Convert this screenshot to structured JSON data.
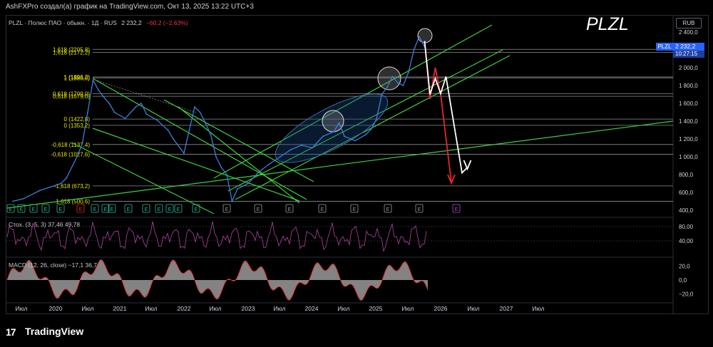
{
  "header": {
    "publisher_text": "AshFXPro создал(а) график на TradingView.com, Окт 13, 2025 13:22 UTC+3"
  },
  "legend": {
    "symbol_line": "PLZL · Полюс ПАО · обыкн. · 1Д · RUS",
    "last": "2 232,2",
    "change": "−60,2 (−2,63%)"
  },
  "big_ticker": "PLZL",
  "currency": "RUB",
  "price_tag": {
    "symbol": "PLZL",
    "value": "2 232,2",
    "time": "10:27:15"
  },
  "colors": {
    "price": "#3d7fd9",
    "fib_line": "#c0c0c0",
    "fib_label": "#e6e600",
    "trend": "#3fcf3f",
    "arrow_red": "#e8262d",
    "arrow_white": "#ffffff",
    "stoch": "#9c3f8f",
    "macd_line": "#e8262d",
    "macd_area": "#9a9a9a",
    "ellipse": "#1a4a8a"
  },
  "chart_data": [
    {
      "type": "line",
      "title": "",
      "series": [
        {
          "name": "",
          "points": [
            [
              "2019-05",
              500
            ],
            [
              "2019-07",
              530
            ],
            [
              "2019-10",
              620
            ],
            [
              "2019-12",
              660
            ],
            [
              "2020-02",
              700
            ],
            [
              "2020-03",
              760
            ],
            [
              "2020-05",
              1000
            ],
            [
              "2020-06",
              1150
            ],
            [
              "2020-07",
              1500
            ],
            [
              "2020-08",
              1860
            ],
            [
              "2020-09",
              1750
            ],
            [
              "2020-10",
              1670
            ],
            [
              "2020-11",
              1600
            ],
            [
              "2020-12",
              1500
            ],
            [
              "2021-02",
              1430
            ],
            [
              "2021-04",
              1560
            ],
            [
              "2021-05",
              1600
            ],
            [
              "2021-06",
              1480
            ],
            [
              "2021-08",
              1410
            ],
            [
              "2021-10",
              1300
            ],
            [
              "2021-11",
              1200
            ],
            [
              "2022-01",
              1040
            ],
            [
              "2022-02",
              1300
            ],
            [
              "2022-03",
              1560
            ],
            [
              "2022-04",
              1500
            ],
            [
              "2022-05",
              1380
            ],
            [
              "2022-06",
              1250
            ],
            [
              "2022-07",
              1000
            ],
            [
              "2022-08",
              880
            ],
            [
              "2022-09",
              800
            ],
            [
              "2022-10",
              500
            ],
            [
              "2022-11",
              640
            ],
            [
              "2023-01",
              700
            ],
            [
              "2023-03",
              830
            ],
            [
              "2023-05",
              920
            ],
            [
              "2023-07",
              1000
            ],
            [
              "2023-09",
              1080
            ],
            [
              "2023-11",
              1130
            ],
            [
              "2024-01",
              1100
            ],
            [
              "2024-03",
              1230
            ],
            [
              "2024-05",
              1280
            ],
            [
              "2024-06",
              1380
            ],
            [
              "2024-07",
              1230
            ],
            [
              "2024-09",
              1180
            ],
            [
              "2024-11",
              1250
            ],
            [
              "2024-12",
              1310
            ],
            [
              "2025-01",
              1420
            ],
            [
              "2025-02",
              1700
            ],
            [
              "2025-03",
              1780
            ],
            [
              "2025-04",
              1900
            ],
            [
              "2025-05",
              1830
            ],
            [
              "2025-06",
              1800
            ],
            [
              "2025-07",
              1950
            ],
            [
              "2025-08",
              2200
            ],
            [
              "2025-09",
              2350
            ],
            [
              "2025-10",
              2232
            ]
          ]
        }
      ],
      "fib_levels": [
        {
          "label": "1,618 (2205,8)",
          "y": 2205.8
        },
        {
          "label": "1,618 (2172,2)",
          "y": 2172.2
        },
        {
          "label": "1 (1896,2)",
          "y": 1896.2
        },
        {
          "label": "1 (1886,0)",
          "y": 1886.0
        },
        {
          "label": "0,618 (1709,0)",
          "y": 1709.0
        },
        {
          "label": "0,618 (1679,0)",
          "y": 1679.0
        },
        {
          "label": "0 (1422,8)",
          "y": 1422.8
        },
        {
          "label": "0 (1353,2)",
          "y": 1353.2
        },
        {
          "label": "-0,618 (1137,4)",
          "y": 1137.4
        },
        {
          "label": "-0,618 (1027,6)",
          "y": 1027.6
        },
        {
          "label": "-1,618 (673,2)",
          "y": 673.2
        },
        {
          "label": "-1,618 (500,6)",
          "y": 500.6
        }
      ],
      "y_ticks": [
        "2 400,0",
        "2 200,0",
        "2 000,0",
        "1 800,0",
        "1 600,0",
        "1 400,0",
        "1 200,0",
        "1 000,0",
        "800,0",
        "600,0",
        "400,0"
      ],
      "x_ticks": [
        "Июл",
        "2020",
        "Июл",
        "2021",
        "Июл",
        "2022",
        "Июл",
        "2023",
        "Июл",
        "2024",
        "Июл",
        "2025",
        "Июл",
        "2026",
        "Июл",
        "2027",
        "Июл"
      ],
      "ylim": [
        400,
        2400
      ],
      "projections": [
        {
          "name": "",
          "color": "red",
          "points": [
            [
              "2025-10",
              2300
            ],
            [
              "2025-11",
              1650
            ],
            [
              "2025-12",
              2000
            ],
            [
              "2026-01",
              1700
            ],
            [
              "2026-03",
              720
            ]
          ]
        },
        {
          "name": "",
          "color": "white",
          "points": [
            [
              "2025-10",
              2300
            ],
            [
              "2025-11",
              1700
            ],
            [
              "2025-12",
              1880
            ],
            [
              "2026-01",
              1710
            ],
            [
              "2026-02",
              1900
            ],
            [
              "2026-05",
              820
            ],
            [
              "2026-06",
              880
            ]
          ]
        }
      ]
    },
    {
      "type": "line",
      "title": "",
      "legend": "Стох. (3, 5, 3)  37,46  49,78",
      "y_ticks": [
        "80,00",
        "40,00"
      ],
      "ylim": [
        0,
        100
      ]
    },
    {
      "type": "area",
      "title": "",
      "legend": "MACD (12, 26, close)  −17,1  36,7",
      "y_ticks": [
        "20,0",
        "0,0",
        "−20,0"
      ],
      "ylim": [
        -30,
        30
      ]
    }
  ],
  "footer": {
    "brand": "TradingView"
  }
}
